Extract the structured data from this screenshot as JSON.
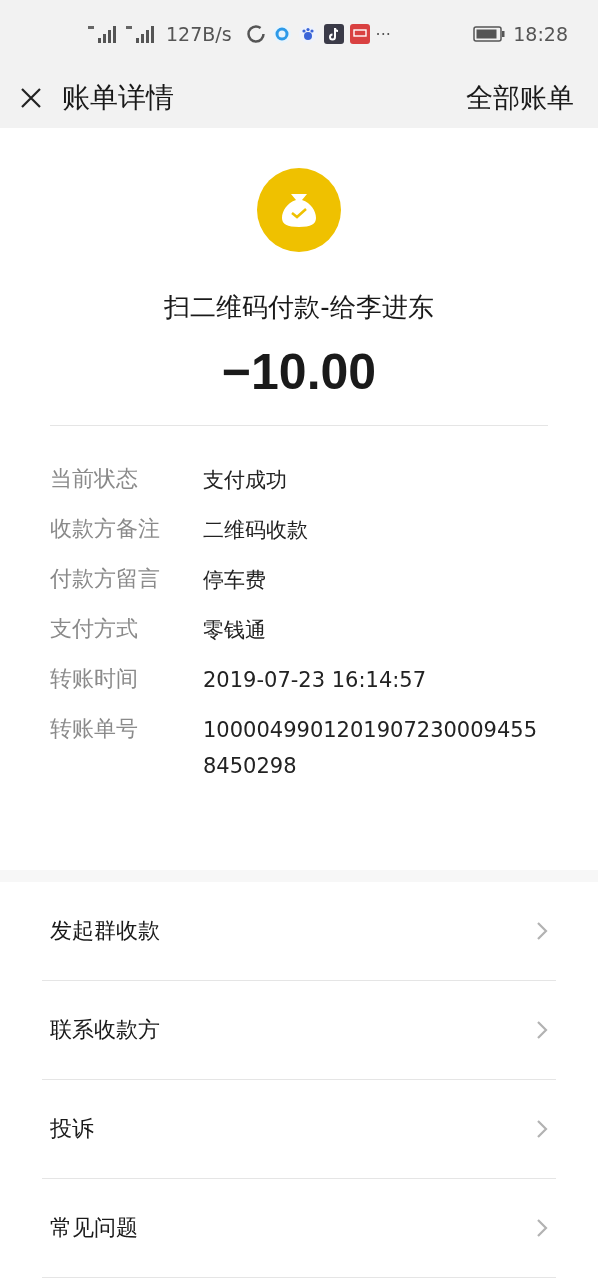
{
  "status_bar": {
    "net_speed": "127B/s",
    "more": "···",
    "time": "18:28"
  },
  "header": {
    "title": "账单详情",
    "action": "全部账单"
  },
  "summary": {
    "title": "扫二维码付款-给李进东",
    "amount": "−10.00"
  },
  "details": [
    {
      "label": "当前状态",
      "value": "支付成功"
    },
    {
      "label": "收款方备注",
      "value": "二维码收款"
    },
    {
      "label": "付款方留言",
      "value": "停车费"
    },
    {
      "label": "支付方式",
      "value": "零钱通"
    },
    {
      "label": "转账时间",
      "value": "2019-07-23 16:14:57"
    },
    {
      "label": "转账单号",
      "value": "10000499012019072300094558450298"
    }
  ],
  "menu": [
    "发起群收款",
    "联系收款方",
    "投诉",
    "常见问题"
  ]
}
